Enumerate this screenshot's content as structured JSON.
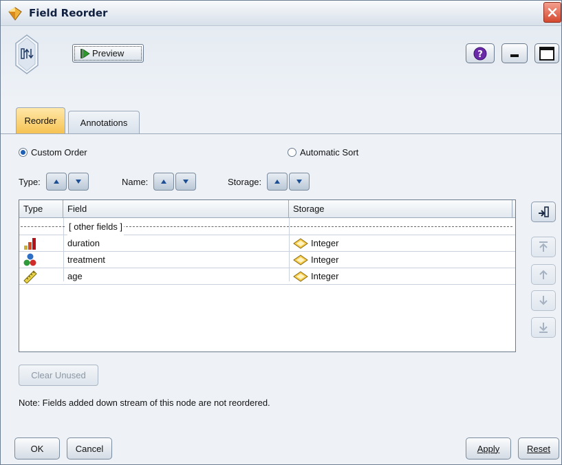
{
  "window": {
    "title": "Field Reorder",
    "close_icon": "close-icon",
    "title_icon": "node-diamond-icon"
  },
  "toolbar": {
    "preview_label": "Preview",
    "help_icon": "help-icon",
    "minimize_icon": "minimize-icon",
    "maximize_icon": "maximize-icon"
  },
  "tabs": [
    {
      "label": "Reorder",
      "active": true
    },
    {
      "label": "Annotations",
      "active": false
    }
  ],
  "order_mode": {
    "custom_label": "Custom Order",
    "automatic_label": "Automatic Sort",
    "selected": "Custom Order"
  },
  "sort_controls": [
    {
      "label": "Type:"
    },
    {
      "label": "Name:"
    },
    {
      "label": "Storage:"
    }
  ],
  "table": {
    "columns": [
      "Type",
      "Field",
      "Storage"
    ],
    "other_fields_label": "[ other fields ]",
    "rows": [
      {
        "type_icon": "continuous-bar-icon",
        "field": "duration",
        "storage": "Integer",
        "storage_icon": "integer-diamond-icon"
      },
      {
        "type_icon": "nominal-balls-icon",
        "field": "treatment",
        "storage": "Integer",
        "storage_icon": "integer-diamond-icon"
      },
      {
        "type_icon": "ruler-icon",
        "field": "age",
        "storage": "Integer",
        "storage_icon": "integer-diamond-icon"
      }
    ]
  },
  "side_buttons": [
    {
      "name": "select-fields-icon",
      "enabled": true
    },
    {
      "name": "move-top-icon",
      "enabled": false
    },
    {
      "name": "move-up-icon",
      "enabled": false
    },
    {
      "name": "move-down-icon",
      "enabled": false
    },
    {
      "name": "move-bottom-icon",
      "enabled": false
    }
  ],
  "clear_unused_label": "Clear Unused",
  "note": "Note: Fields added down stream of this node are not reordered.",
  "footer": {
    "ok_label": "OK",
    "cancel_label": "Cancel",
    "apply_label": "Apply",
    "reset_label": "Reset"
  },
  "colors": {
    "active_tab": "#f6c353",
    "accent_blue": "#1d5fb5"
  }
}
